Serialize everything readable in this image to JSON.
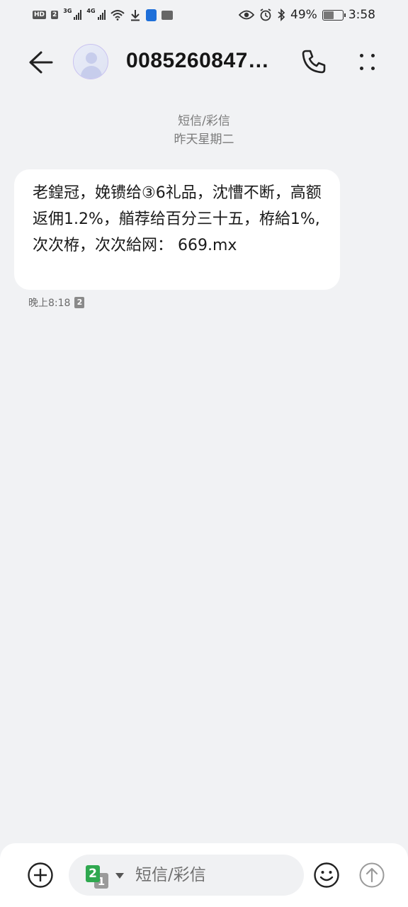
{
  "status_bar": {
    "hd_badge": "HD",
    "sim1_badge": "2",
    "net1": "3G",
    "net2": "4G",
    "hms_label": "HMS",
    "battery_pct": "49%",
    "battery_level": 0.49,
    "time": "3:58"
  },
  "header": {
    "contact": "0085260847…"
  },
  "thread": {
    "channel": "短信/彩信",
    "date": "昨天星期二"
  },
  "message": {
    "body": "老鍠冠，娩镄给③6礼品，沈慒不断，高额返佣1.2%，艏荐给百分三十五，栫給1%,次次栫，次次給网： 669.mx",
    "time": "晚上8:18",
    "sim": "2"
  },
  "composer": {
    "sim_primary": "2",
    "sim_secondary": "1",
    "placeholder": "短信/彩信"
  },
  "colors": {
    "background": "#f1f2f4",
    "bubble": "#ffffff",
    "sim_green": "#2fa84f"
  }
}
